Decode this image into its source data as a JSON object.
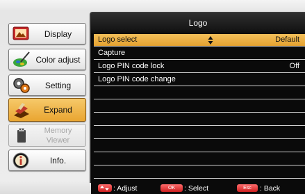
{
  "menu": {
    "items": [
      {
        "label": "Display",
        "icon": "display-icon"
      },
      {
        "label": "Color adjust",
        "icon": "color-adjust-icon"
      },
      {
        "label": "Setting",
        "icon": "setting-icon"
      },
      {
        "label": "Expand",
        "icon": "expand-icon",
        "active": true
      },
      {
        "label": "Memory Viewer",
        "icon": "memory-viewer-icon",
        "disabled": true
      },
      {
        "label": "Info.",
        "icon": "info-icon"
      }
    ]
  },
  "panel": {
    "title": "Logo",
    "rows": [
      {
        "name": "Logo select",
        "value": "Default",
        "selected": true
      },
      {
        "name": "Capture",
        "value": ""
      },
      {
        "name": "Logo PIN code lock",
        "value": "Off"
      },
      {
        "name": "Logo PIN code change",
        "value": ""
      },
      {
        "name": "",
        "value": ""
      },
      {
        "name": "",
        "value": ""
      },
      {
        "name": "",
        "value": ""
      },
      {
        "name": "",
        "value": ""
      },
      {
        "name": "",
        "value": ""
      },
      {
        "name": "",
        "value": ""
      },
      {
        "name": "",
        "value": ""
      },
      {
        "name": "",
        "value": ""
      }
    ]
  },
  "help": {
    "adjust_label": ": Adjust",
    "ok_key": "OK",
    "select_label": ": Select",
    "esc_key": "Esc",
    "back_label": ": Back"
  },
  "colors": {
    "highlight": "#eead3f",
    "panel_bg": "#0a0a0a",
    "key_red": "#e03030"
  }
}
